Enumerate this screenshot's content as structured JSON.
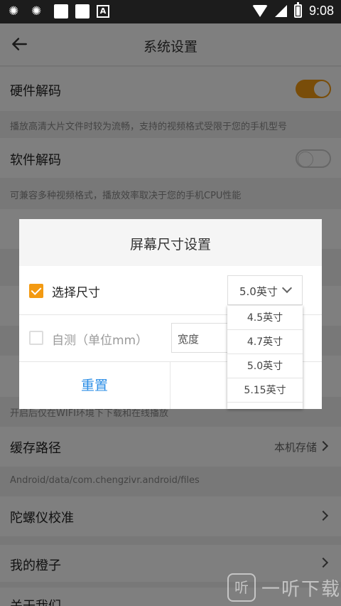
{
  "status_bar": {
    "time": "9:08",
    "a_badge": "A"
  },
  "header": {
    "title": "系统设置"
  },
  "settings": [
    {
      "label": "硬件解码",
      "desc": "播放高清大片文件时较为流畅，支持的视频格式受限于您的手机型号",
      "toggle": true
    },
    {
      "label": "软件解码",
      "desc": "可兼容多种视频格式，播放效率取决于您的手机CPU性能",
      "toggle": false
    },
    {
      "label": "缓存路径",
      "value": "本机存储",
      "desc": "Android/data/com.chengzivr.android/files"
    },
    {
      "label": "陀螺仪校准"
    },
    {
      "label": "我的橙子"
    },
    {
      "label": "关于我们"
    }
  ],
  "obscured": {
    "wifi_desc_partial": "开启后仅在WIFI环境下下载和在线播放"
  },
  "dialog": {
    "title": "屏幕尺寸设置",
    "select_size_label": "选择尺寸",
    "selected_size": "5.0英寸",
    "self_measure_label": "自测（单位mm）",
    "width_placeholder": "宽度",
    "reset_button": "重置",
    "size_options": [
      "4.5英寸",
      "4.7英寸",
      "5.0英寸",
      "5.15英寸"
    ]
  },
  "watermark": {
    "glyph": "听",
    "text": "一听下载"
  },
  "colors": {
    "accent": "#f39a12",
    "link": "#2a8de6"
  }
}
